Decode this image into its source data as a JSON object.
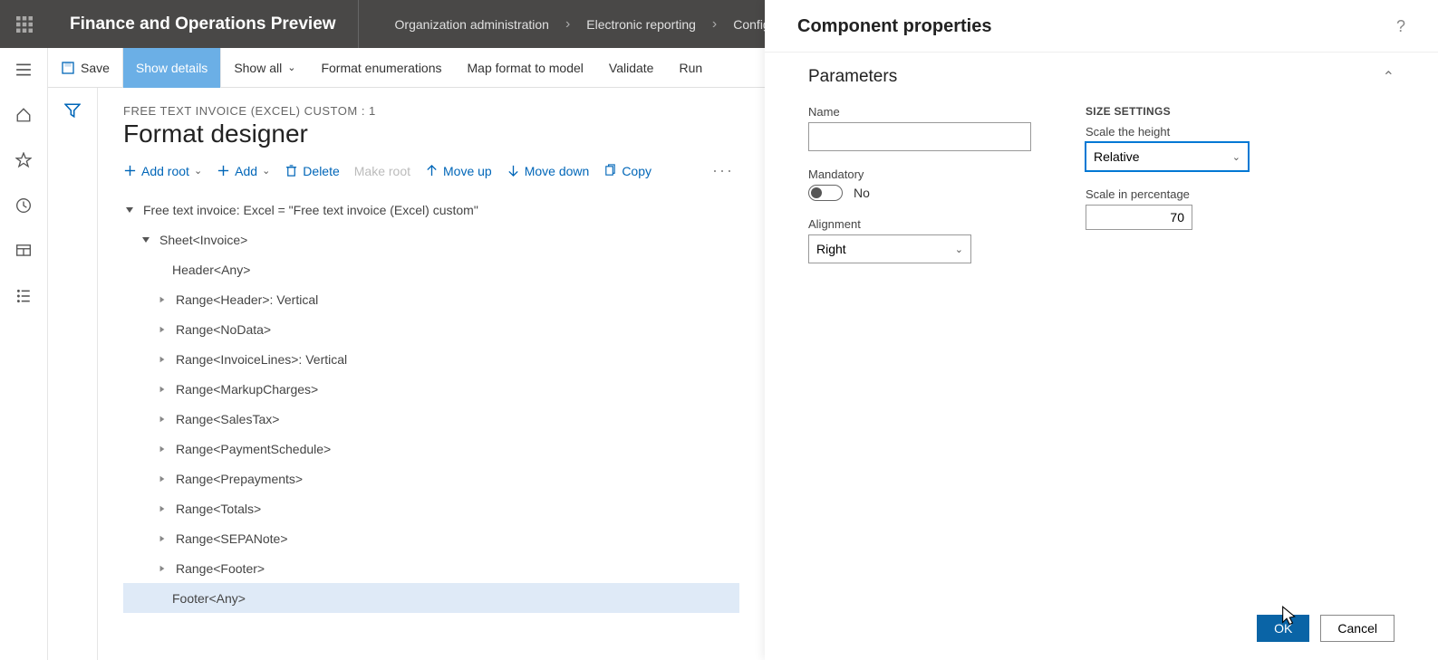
{
  "topbar": {
    "app_title": "Finance and Operations Preview",
    "breadcrumb": [
      "Organization administration",
      "Electronic reporting",
      "Configurations"
    ]
  },
  "cmdbar": {
    "save": "Save",
    "show_details": "Show details",
    "show_all": "Show all",
    "format_enum": "Format enumerations",
    "map_format": "Map format to model",
    "validate": "Validate",
    "run": "Run"
  },
  "main": {
    "crumb": "FREE TEXT INVOICE (EXCEL) CUSTOM : 1",
    "title": "Format designer",
    "toolbar": {
      "add_root": "Add root",
      "add": "Add",
      "delete": "Delete",
      "make_root": "Make root",
      "move_up": "Move up",
      "move_down": "Move down",
      "copy": "Copy"
    },
    "tree": {
      "root": "Free text invoice: Excel = \"Free text invoice (Excel) custom\"",
      "sheet": "Sheet<Invoice>",
      "items": [
        "Header<Any>",
        "Range<Header>: Vertical",
        "Range<NoData>",
        "Range<InvoiceLines>: Vertical",
        "Range<MarkupCharges>",
        "Range<SalesTax>",
        "Range<PaymentSchedule>",
        "Range<Prepayments>",
        "Range<Totals>",
        "Range<SEPANote>",
        "Range<Footer>",
        "Footer<Any>"
      ]
    }
  },
  "panel": {
    "title": "Component properties",
    "section": "Parameters",
    "name_label": "Name",
    "name_value": "",
    "mandatory_label": "Mandatory",
    "mandatory_value": "No",
    "alignment_label": "Alignment",
    "alignment_value": "Right",
    "size_settings": "SIZE SETTINGS",
    "scale_height_label": "Scale the height",
    "scale_height_value": "Relative",
    "scale_pct_label": "Scale in percentage",
    "scale_pct_value": "70",
    "ok": "OK",
    "cancel": "Cancel"
  },
  "leftrail_icons": [
    "menu",
    "home",
    "star",
    "recent",
    "workspace",
    "list"
  ]
}
